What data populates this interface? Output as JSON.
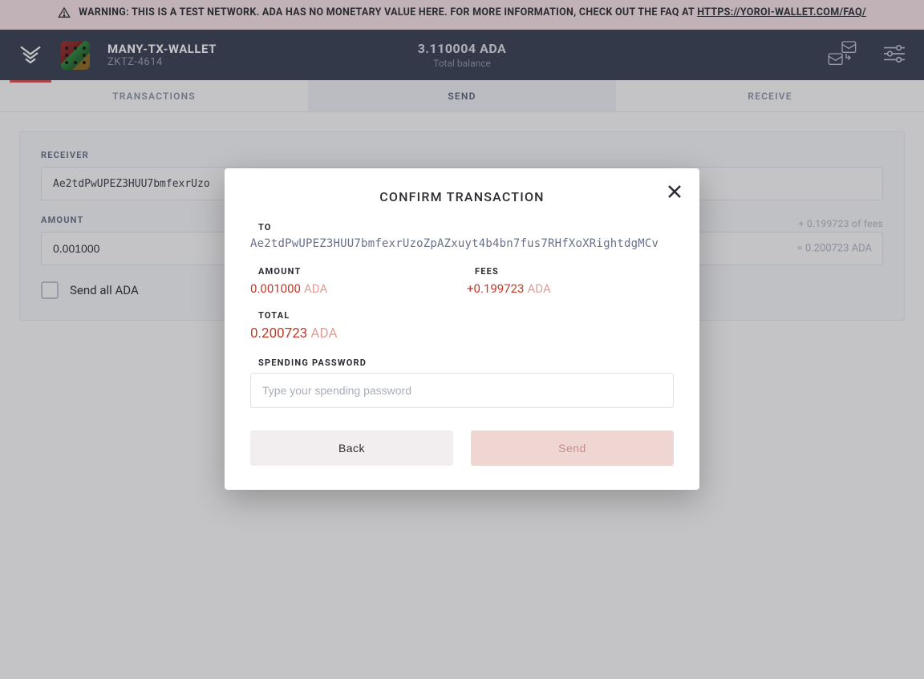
{
  "banner": {
    "text": "WARNING: THIS IS A TEST NETWORK. ADA HAS NO MONETARY VALUE HERE. FOR MORE INFORMATION, CHECK OUT THE FAQ AT ",
    "link_text": "HTTPS://YOROI-WALLET.COM/FAQ/"
  },
  "header": {
    "wallet_name": "MANY-TX-WALLET",
    "wallet_id": "ZKTZ-4614",
    "balance": "3.110004 ADA",
    "balance_label": "Total balance"
  },
  "tabs": {
    "transactions": "TRANSACTIONS",
    "send": "SEND",
    "receive": "RECEIVE",
    "active": "send"
  },
  "form": {
    "receiver_label": "RECEIVER",
    "receiver_value": "Ae2tdPwUPEZ3HUU7bmfexrUzo",
    "amount_label": "AMOUNT",
    "amount_value": "0.001000",
    "fees_note": "+ 0.199723 of fees",
    "eq_note": "= 0.200723 ADA",
    "send_all_label": "Send all ADA"
  },
  "modal": {
    "title": "CONFIRM TRANSACTION",
    "to_label": "TO",
    "to_value": "Ae2tdPwUPEZ3HUU7bmfexrUzoZpAZxuyt4b4bn7fus7RHfXoXRightdgMCv",
    "amount_label": "AMOUNT",
    "amount_value": "0.001000",
    "amount_unit": "ADA",
    "fees_label": "FEES",
    "fees_value": "+0.199723",
    "fees_unit": "ADA",
    "total_label": "TOTAL",
    "total_value": "0.200723",
    "total_unit": "ADA",
    "password_label": "SPENDING PASSWORD",
    "password_placeholder": "Type your spending password",
    "back": "Back",
    "send": "Send"
  }
}
